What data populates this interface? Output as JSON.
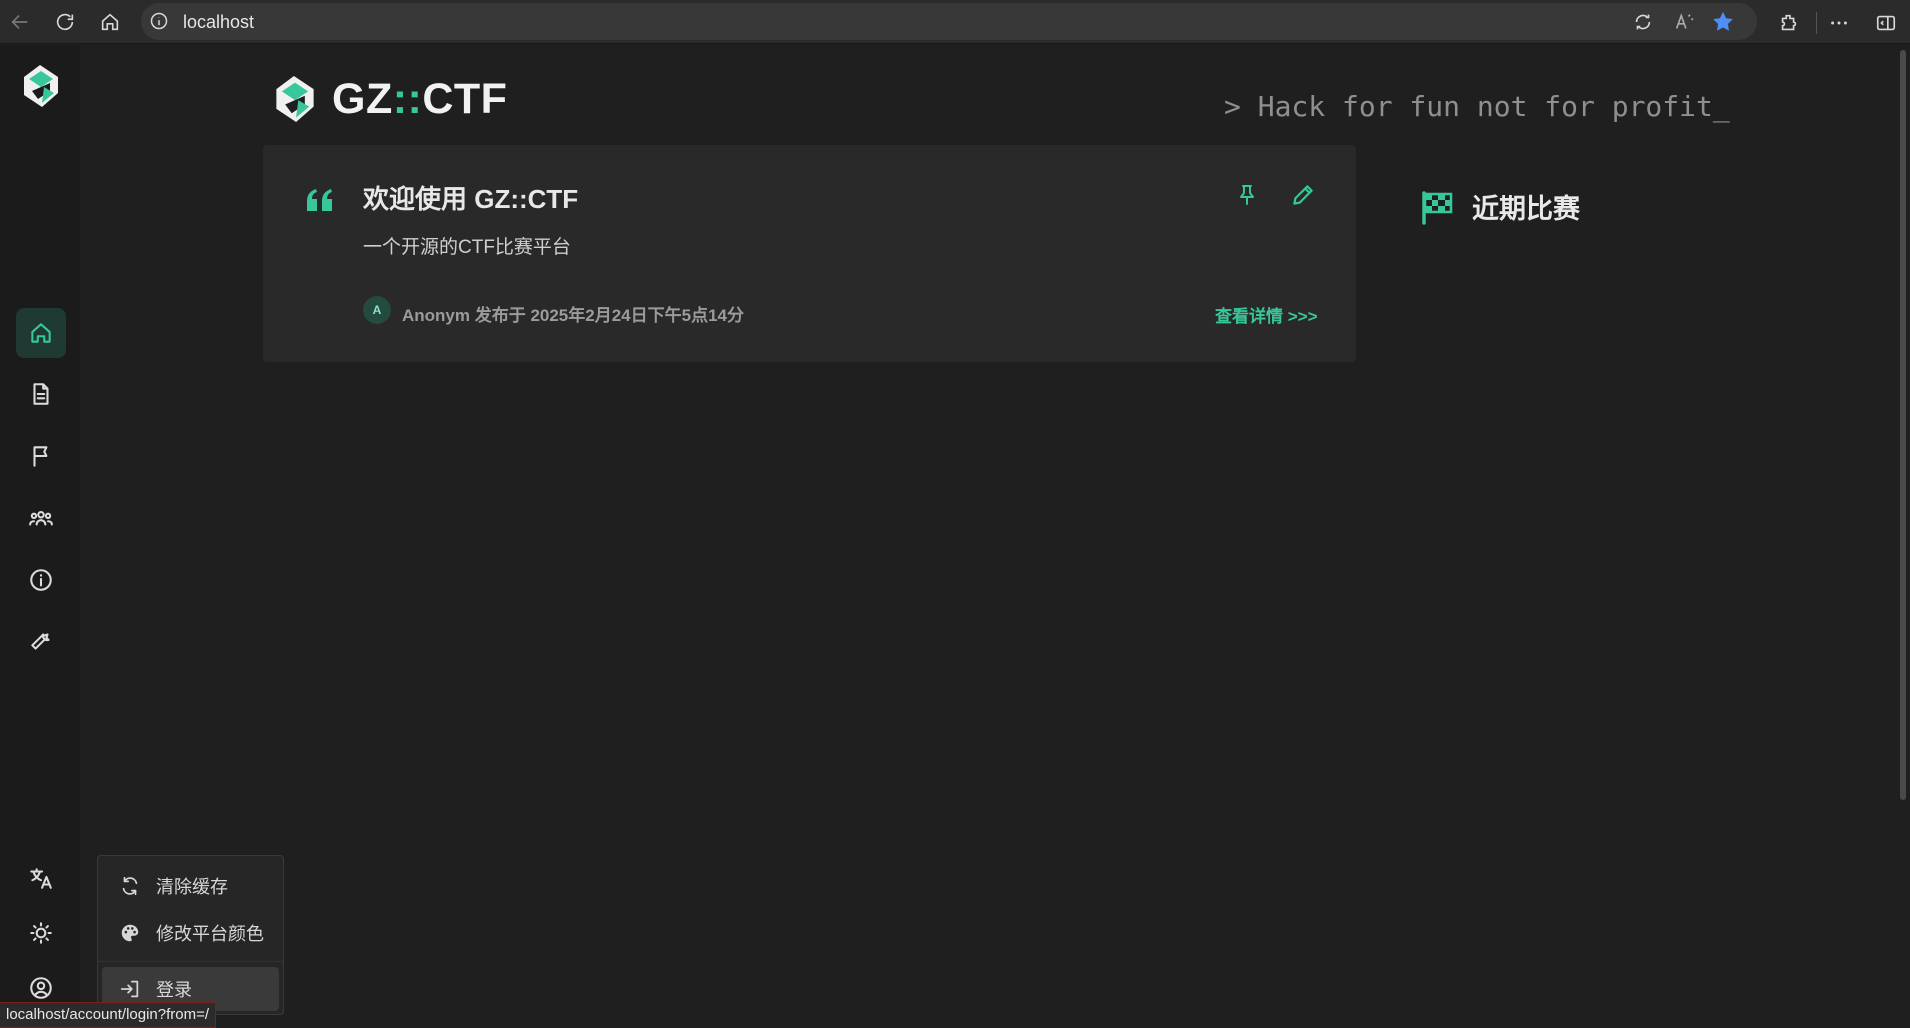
{
  "browser": {
    "url": "localhost",
    "icons": [
      "back-icon",
      "refresh-icon",
      "home-icon",
      "info-icon",
      "translate-page-icon",
      "read-aloud-icon",
      "favorite-star-icon",
      "extensions-icon",
      "more-icon",
      "sidebar-toggle-icon"
    ]
  },
  "sidebar": {
    "items": [
      {
        "name": "home",
        "icon": "home-icon",
        "active": true
      },
      {
        "name": "posts",
        "icon": "document-icon",
        "active": false
      },
      {
        "name": "games",
        "icon": "flag-icon",
        "active": false
      },
      {
        "name": "teams",
        "icon": "users-icon",
        "active": false
      },
      {
        "name": "about",
        "icon": "info-icon",
        "active": false
      },
      {
        "name": "admin",
        "icon": "wrench-icon",
        "active": false
      }
    ],
    "bottom": [
      {
        "name": "language",
        "icon": "language-icon"
      },
      {
        "name": "theme",
        "icon": "sun-icon"
      },
      {
        "name": "account",
        "icon": "user-circle-icon"
      }
    ]
  },
  "header": {
    "brand_prefix": "GZ",
    "brand_sep": "::",
    "brand_suffix": "CTF",
    "slogan": "> Hack for fun not for profit_"
  },
  "notice": {
    "title": "欢迎使用 GZ::CTF",
    "subtitle": "一个开源的CTF比赛平台",
    "avatar_letter": "A",
    "meta": "Anonym 发布于 2025年2月24日下午5点14分",
    "details_link": "查看详情 >>>"
  },
  "recent_games": {
    "label": "近期比赛"
  },
  "menu": {
    "items": [
      {
        "label": "清除缓存",
        "icon": "refresh-cache-icon"
      },
      {
        "label": "修改平台颜色",
        "icon": "palette-icon"
      },
      {
        "label": "登录",
        "icon": "login-icon"
      }
    ]
  },
  "status_url": "localhost/account/login?from=/",
  "colors": {
    "accent": "#38c79a",
    "background": "#1f1f1f",
    "card": "#292929",
    "sidebar": "#1b1b1b"
  }
}
